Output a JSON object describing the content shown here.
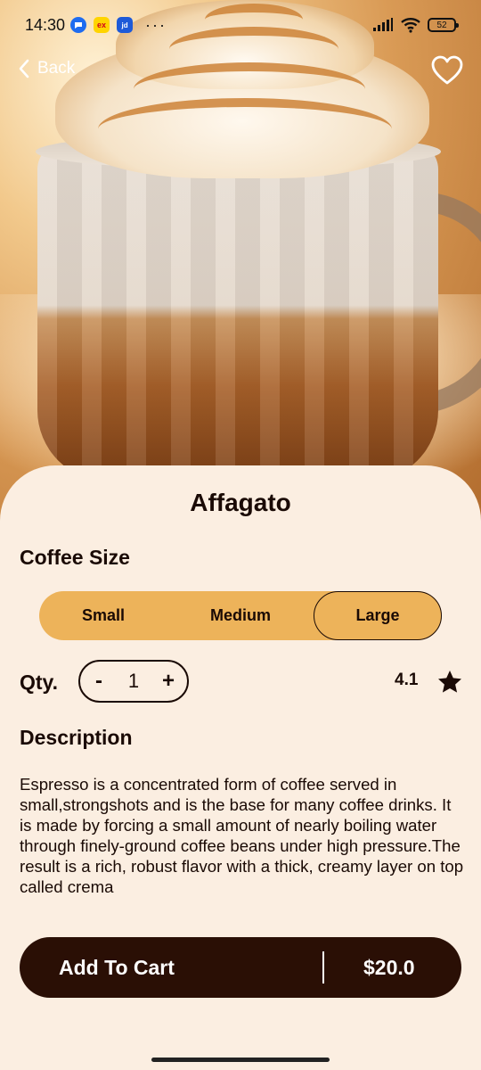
{
  "status_bar": {
    "time": "14:30",
    "notification_icons": [
      "chat-icon",
      "ex-icon",
      "app-icon"
    ],
    "ex_label": "ex",
    "app_label": "jd",
    "more": "···",
    "battery": "52"
  },
  "nav": {
    "back_label": "Back",
    "favorite_icon": "heart-icon"
  },
  "product": {
    "name": "Affagato",
    "hero_image": "coffee-mug-with-foam"
  },
  "size": {
    "label": "Coffee Size",
    "options": [
      "Small",
      "Medium",
      "Large"
    ],
    "selected": "Large"
  },
  "quantity": {
    "label": "Qty.",
    "minus": "-",
    "value": "1",
    "plus": "+"
  },
  "rating": {
    "value": "4.1",
    "icon": "star-icon"
  },
  "description": {
    "label": "Description",
    "text": "Espresso is a concentrated form of coffee served in small,strongshots and is the base for many coffee drinks. It is made by forcing a small amount of nearly boiling water through finely-ground coffee beans under high pressure.The result is a rich, robust flavor with a thick, creamy layer on top called crema"
  },
  "cart": {
    "label": "Add To Cart",
    "price": "$20.0"
  },
  "colors": {
    "background": "#FBEEE1",
    "accent": "#EDB35A",
    "dark": "#2a0f05"
  }
}
